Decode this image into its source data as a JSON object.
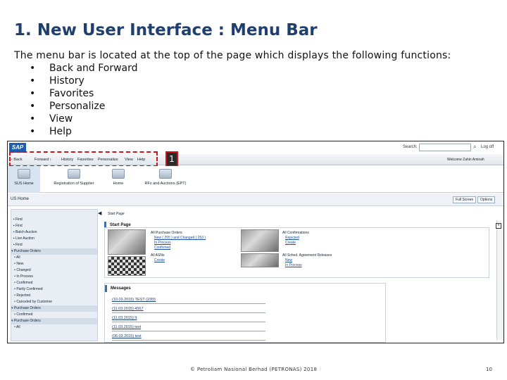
{
  "title": "1. New User Interface : Menu Bar",
  "intro": "The menu bar is located at the top of the page which displays the following functions:",
  "bullets": [
    "Back and Forward",
    "History",
    "Favorites",
    "Personalize",
    "View",
    "Help"
  ],
  "screenshot": {
    "logo": "SAP",
    "search_label": "Search:",
    "logoff": "Log off",
    "welcome": "Welcome Zahin Aminah",
    "callout": "1",
    "menu": [
      "Back",
      "Forward",
      "History",
      "Favorites",
      "Personalize",
      "View",
      "Help"
    ],
    "tabs": [
      "SUS Home",
      "Registration of Supplier",
      "Home",
      "RFx and Auctions (EPT)"
    ],
    "page_header": "US Home",
    "buttons": [
      "Full Screen",
      "Options"
    ],
    "start_page": "Start Page",
    "start_page_head": "Start Page",
    "sidebar": [
      {
        "label": "Find",
        "group": false
      },
      {
        "label": "Find",
        "group": false
      },
      {
        "label": "Batch Auction",
        "group": false
      },
      {
        "label": "Live Auction",
        "group": false
      },
      {
        "label": "Find",
        "group": false
      },
      {
        "label": "Purchase Orders",
        "group": true
      },
      {
        "label": "All",
        "group": false
      },
      {
        "label": "New",
        "group": false
      },
      {
        "label": "Changed",
        "group": false
      },
      {
        "label": "In Process",
        "group": false
      },
      {
        "label": "Confirmed",
        "group": false
      },
      {
        "label": "Partly Confirmed",
        "group": false
      },
      {
        "label": "Rejected",
        "group": false
      },
      {
        "label": "Canceled by Customer",
        "group": false
      },
      {
        "label": "Purchase Orders",
        "group": true
      },
      {
        "label": "Confirmed",
        "group": false
      },
      {
        "label": "Purchase Orders",
        "group": true
      },
      {
        "label": "All",
        "group": false
      }
    ],
    "po_block": {
      "title": "All Purchase Orders",
      "new_line": "New ( 255 ) and Changed ( 253 )",
      "links": [
        "In Process",
        "Confirmed"
      ]
    },
    "asn_block": {
      "title": "All ASNs",
      "links": [
        "Create"
      ]
    },
    "conf_block": {
      "title": "All Confirmations",
      "links": [
        "Rejected",
        "Create"
      ]
    },
    "sched_block": {
      "title": "All Sched. Agreement Releases",
      "links": [
        "New",
        "In Process"
      ]
    },
    "messages_head": "Messages",
    "messages": [
      "(10.03.2015) TEST (2355",
      "(11.03.2015) 4567",
      "(11.03.2015) It",
      "(11.03.2015) test",
      "(06.03.2015) test"
    ]
  },
  "footer": "© Petroliam Nasional Berhad (PETRONAS) 2018",
  "page_number": "10"
}
